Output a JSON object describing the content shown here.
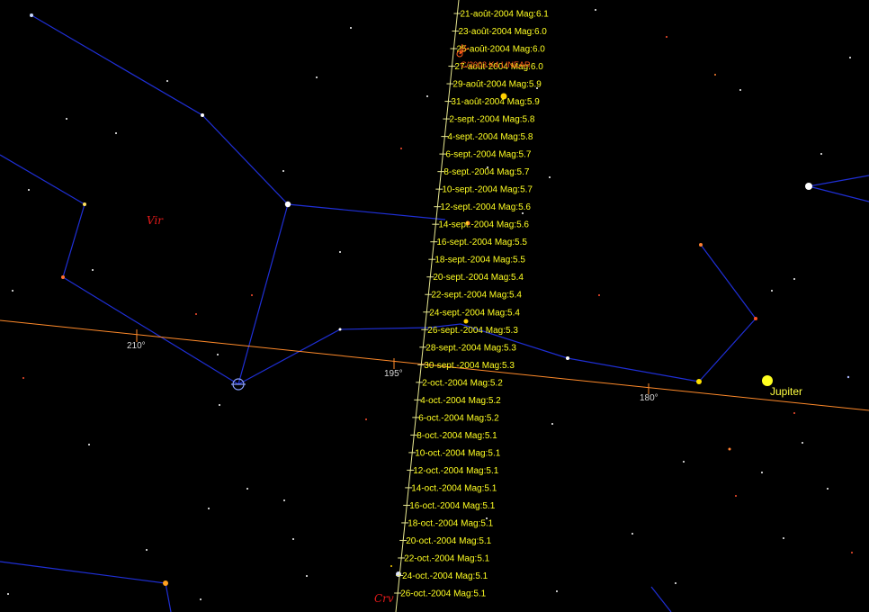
{
  "colors": {
    "background": "#000000",
    "constellation_lines": "#1f2fd6",
    "ecliptic": "#ff8a2a",
    "ecliptic_labels": "#d8d8d8",
    "track": "#e8e890",
    "track_labels": "#ffff22",
    "comet": "#ff5a1a",
    "constellation_names": "#e41a1a",
    "jupiter_label": "#ffff40"
  },
  "constellations": [
    "Vir",
    "Crv"
  ],
  "ecliptic_ticks": [
    "210°",
    "195°",
    "180°"
  ],
  "comet": {
    "name": "C/2003 K4 LINEAR",
    "icon": "comet-icon"
  },
  "planets": [
    {
      "name": "Jupiter"
    }
  ],
  "track_positions": [
    {
      "date": "21-août-2004",
      "mag": "Mag:6.1"
    },
    {
      "date": "23-août-2004",
      "mag": "Mag:6.0"
    },
    {
      "date": "25-août-2004",
      "mag": "Mag:6.0"
    },
    {
      "date": "27-août-2004",
      "mag": "Mag:6.0"
    },
    {
      "date": "29-août-2004",
      "mag": "Mag:5.9"
    },
    {
      "date": "31-août-2004",
      "mag": "Mag:5.9"
    },
    {
      "date": "2-sept.-2004",
      "mag": "Mag:5.8"
    },
    {
      "date": "4-sept.-2004",
      "mag": "Mag:5.8"
    },
    {
      "date": "6-sept.-2004",
      "mag": "Mag:5.7"
    },
    {
      "date": "8-sept.-2004",
      "mag": "Mag:5.7"
    },
    {
      "date": "10-sept.-2004",
      "mag": "Mag:5.7"
    },
    {
      "date": "12-sept.-2004",
      "mag": "Mag:5.6"
    },
    {
      "date": "14-sept.-2004",
      "mag": "Mag:5.6"
    },
    {
      "date": "16-sept.-2004",
      "mag": "Mag:5.5"
    },
    {
      "date": "18-sept.-2004",
      "mag": "Mag:5.5"
    },
    {
      "date": "20-sept.-2004",
      "mag": "Mag:5.4"
    },
    {
      "date": "22-sept.-2004",
      "mag": "Mag:5.4"
    },
    {
      "date": "24-sept.-2004",
      "mag": "Mag:5.4"
    },
    {
      "date": "26-sept.-2004",
      "mag": "Mag:5.3"
    },
    {
      "date": "28-sept.-2004",
      "mag": "Mag:5.3"
    },
    {
      "date": "30-sept.-2004",
      "mag": "Mag:5.3"
    },
    {
      "date": "2-oct.-2004",
      "mag": "Mag:5.2"
    },
    {
      "date": "4-oct.-2004",
      "mag": "Mag:5.2"
    },
    {
      "date": "6-oct.-2004",
      "mag": "Mag:5.2"
    },
    {
      "date": "8-oct.-2004",
      "mag": "Mag:5.1"
    },
    {
      "date": "10-oct.-2004",
      "mag": "Mag:5.1"
    },
    {
      "date": "12-oct.-2004",
      "mag": "Mag:5.1"
    },
    {
      "date": "14-oct.-2004",
      "mag": "Mag:5.1"
    },
    {
      "date": "16-oct.-2004",
      "mag": "Mag:5.1"
    },
    {
      "date": "18-oct.-2004",
      "mag": "Mag:5.1"
    },
    {
      "date": "20-oct.-2004",
      "mag": "Mag:5.1"
    },
    {
      "date": "22-oct.-2004",
      "mag": "Mag:5.1"
    },
    {
      "date": "24-oct.-2004",
      "mag": "Mag:5.1"
    },
    {
      "date": "26-oct.-2004",
      "mag": "Mag:5.1"
    }
  ]
}
